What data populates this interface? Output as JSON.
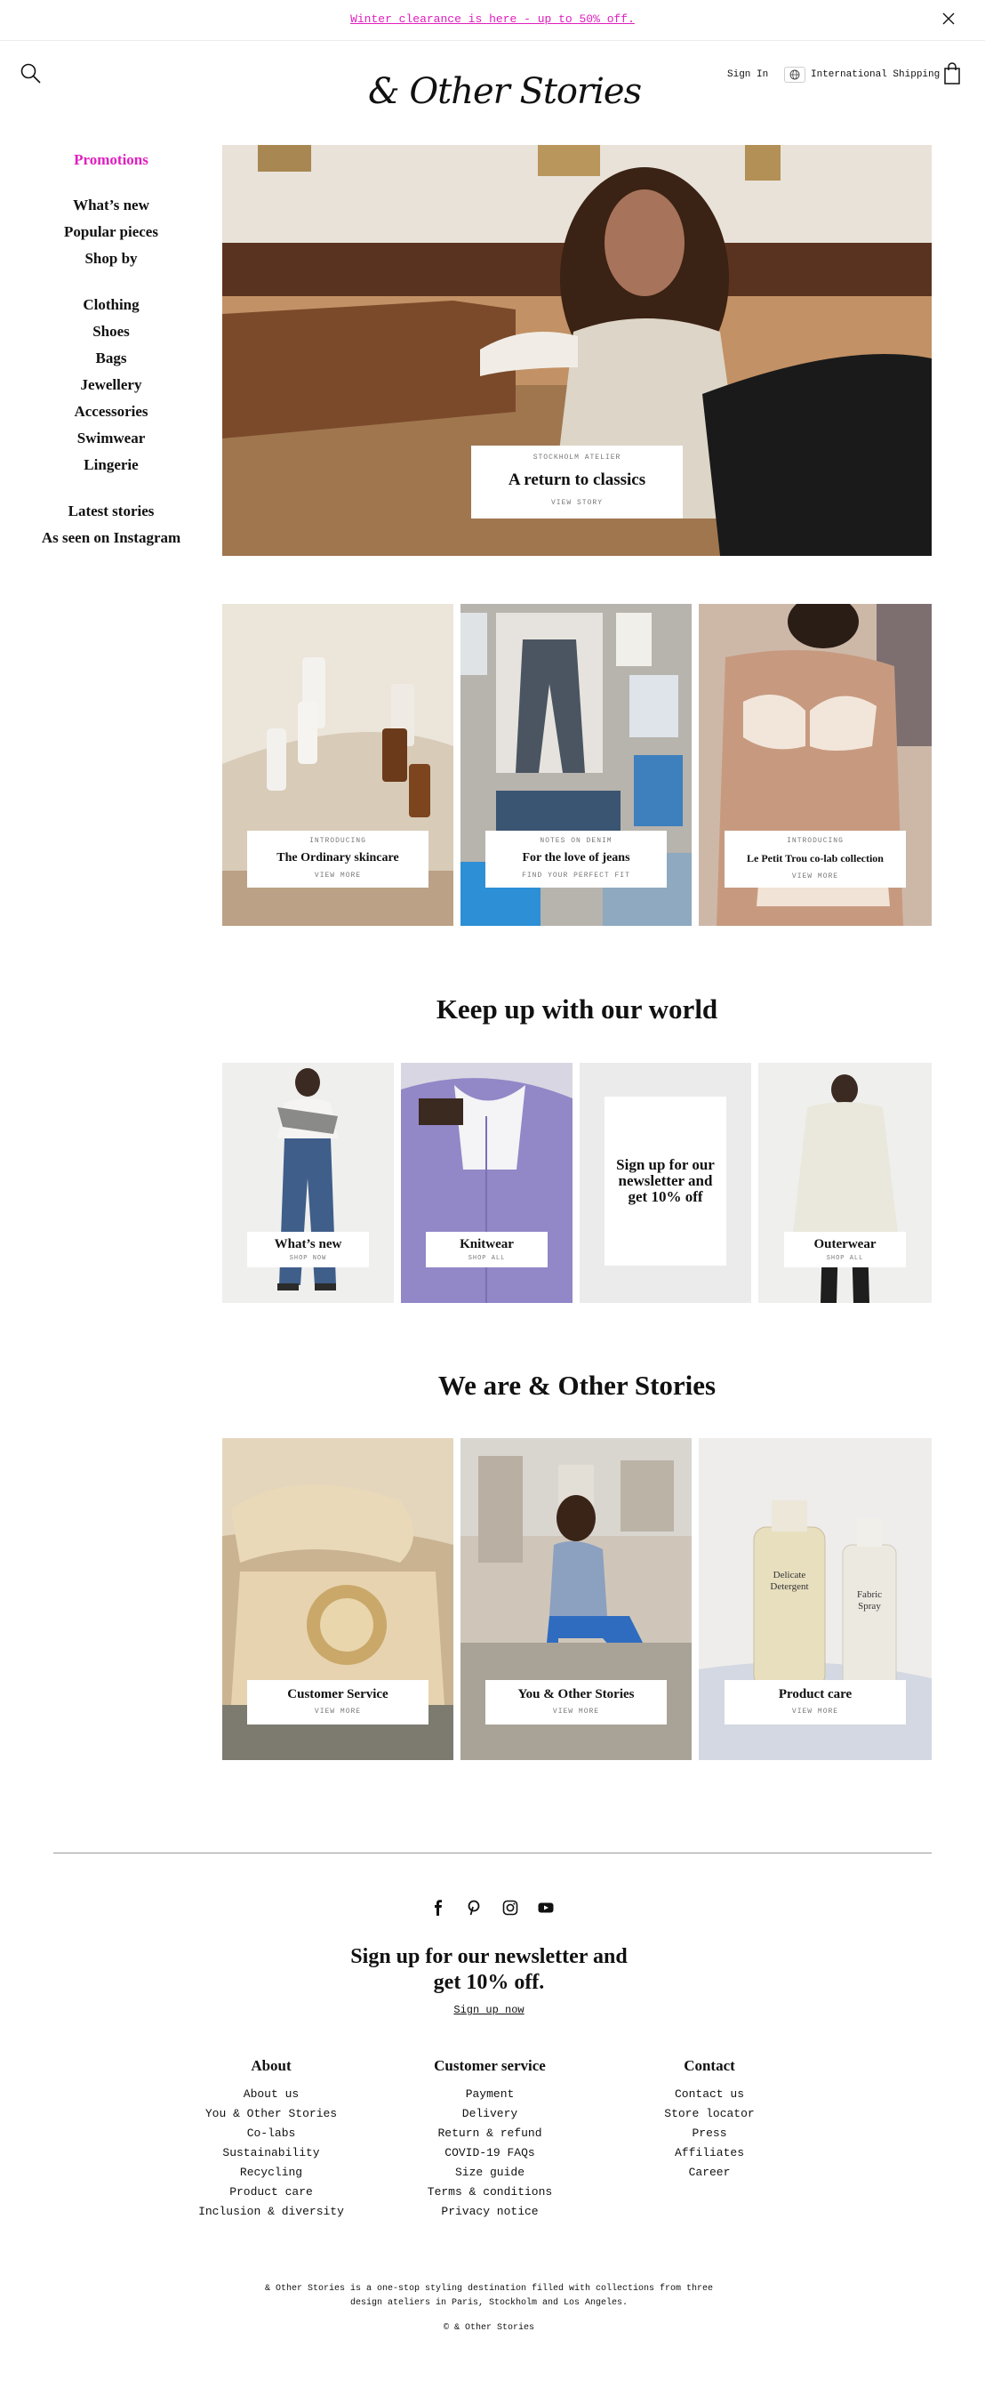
{
  "announcement": {
    "text": "Winter clearance is here - up to 50% off."
  },
  "header": {
    "logo": "& Other Stories",
    "sign_in": "Sign In",
    "shipping": "International Shipping",
    "icons": [
      "search-icon",
      "globe-icon",
      "bag-icon",
      "close-icon"
    ]
  },
  "nav": {
    "promotions": "Promotions",
    "group1": [
      "What’s new",
      "Popular pieces",
      "Shop by"
    ],
    "group2": [
      "Clothing",
      "Shoes",
      "Bags",
      "Jewellery",
      "Accessories",
      "Swimwear",
      "Lingerie"
    ],
    "group3": [
      "Latest stories",
      "As seen on Instagram"
    ]
  },
  "hero": {
    "kicker": "STOCKHOLM ATELIER",
    "title": "A return to classics",
    "link": "VIEW STORY"
  },
  "feature_tiles": [
    {
      "kicker": "INTRODUCING",
      "title": "The Ordinary skincare",
      "link": "VIEW MORE"
    },
    {
      "kicker": "NOTES ON DENIM",
      "title": "For the love of jeans",
      "link": "FIND YOUR PERFECT FIT"
    },
    {
      "kicker": "INTRODUCING",
      "title": "Le Petit Trou co-lab collection",
      "link": "VIEW MORE"
    }
  ],
  "keep_up": {
    "heading": "Keep up with our world",
    "tiles": [
      {
        "title": "What’s new",
        "link": "SHOP NOW"
      },
      {
        "title": "Knitwear",
        "link": "SHOP ALL"
      },
      {
        "title": "Sign up for our newsletter and get 10% off",
        "link": ""
      },
      {
        "title": "Outerwear",
        "link": "SHOP ALL"
      }
    ]
  },
  "we_are": {
    "heading": "We are & Other Stories",
    "tiles": [
      {
        "title": "Customer Service",
        "link": "VIEW MORE",
        "product_text": ""
      },
      {
        "title": "You & Other Stories",
        "link": "VIEW MORE",
        "product_text": ""
      },
      {
        "title": "Product care",
        "link": "VIEW MORE",
        "bottle1": "Delicate Detergent",
        "bottle2": "Fabric Spray"
      }
    ]
  },
  "footer": {
    "social": [
      "facebook-icon",
      "pinterest-icon",
      "instagram-icon",
      "youtube-icon"
    ],
    "newsletter_line1": "Sign up for our newsletter and",
    "newsletter_line2": "get 10% off.",
    "signup_link": "Sign up now",
    "columns": [
      {
        "heading": "About",
        "links": [
          "About us",
          "You & Other Stories",
          "Co-labs",
          "Sustainability",
          "Recycling",
          "Product care",
          "Inclusion & diversity"
        ]
      },
      {
        "heading": "Customer service",
        "links": [
          "Payment",
          "Delivery",
          "Return & refund",
          "COVID-19 FAQs",
          "Size guide",
          "Terms & conditions",
          "Privacy notice"
        ]
      },
      {
        "heading": "Contact",
        "links": [
          "Contact us",
          "Store locator",
          "Press",
          "Affiliates",
          "Career"
        ]
      }
    ],
    "blurb_line1": "& Other Stories is a one-stop styling destination filled with collections from three",
    "blurb_line2": "design ateliers in Paris, Stockholm and Los Angeles.",
    "copyright": "© & Other Stories"
  },
  "colors": {
    "accent": "#e01fbf",
    "text": "#111111",
    "muted": "#777777"
  }
}
